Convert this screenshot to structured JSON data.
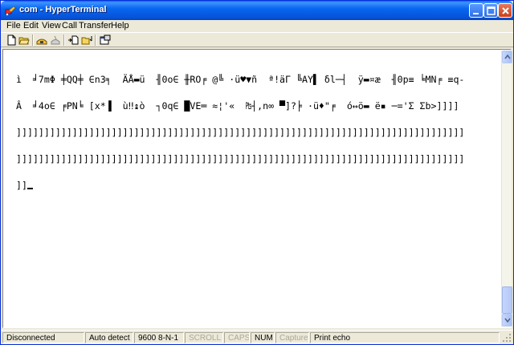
{
  "window": {
    "title": "com - HyperTerminal"
  },
  "menu": {
    "items": [
      "File",
      "Edit",
      "View",
      "Call",
      "Transfer",
      "Help"
    ]
  },
  "toolbar": {
    "icons": [
      "new-icon",
      "open-icon",
      "connect-icon",
      "disconnect-icon",
      "send-icon",
      "receive-icon",
      "properties-icon"
    ]
  },
  "terminal": {
    "lines": [
      "ì  ╛7mΦ ╪QQ╪ ∈n3╕  ÄÅ▬ü  ╢0o∈ ╫RO╒ @╚ ·ü♥▼ñ  ª!äΓ ╚AY▌ δl─┤  ÿ▬¤æ  ╢0p≡ ╘MN╒ ≡q-",
      "Â  ╛4o∈ ╒PN╘ [x*▐  ù‼↨ò  ┐0q∈ █VE═ ≈¦'«  ₧┤,n∞ ▀]?╞ ·ü♦\"╒  ó↔ö▬ ë▪ ─='Σ Σb>]]]]",
      "]]]]]]]]]]]]]]]]]]]]]]]]]]]]]]]]]]]]]]]]]]]]]]]]]]]]]]]]]]]]]]]]]]]]]]]]]]]]]]]]",
      "]]]]]]]]]]]]]]]]]]]]]]]]]]]]]]]]]]]]]]]]]]]]]]]]]]]]]]]]]]]]]]]]]]]]]]]]]]]]]]]]",
      "]]"
    ]
  },
  "status": {
    "connection": "Disconnected",
    "detect": "Auto detect",
    "settings": "9600 8-N-1",
    "scroll": "SCROLL",
    "caps": "CAPS",
    "num": "NUM",
    "capture": "Capture",
    "print_echo": "Print echo"
  },
  "colors": {
    "titlebar": "#0653d9",
    "face": "#ece9d8",
    "terminal_bg": "#ffffff",
    "disabled_text": "#aca899"
  }
}
